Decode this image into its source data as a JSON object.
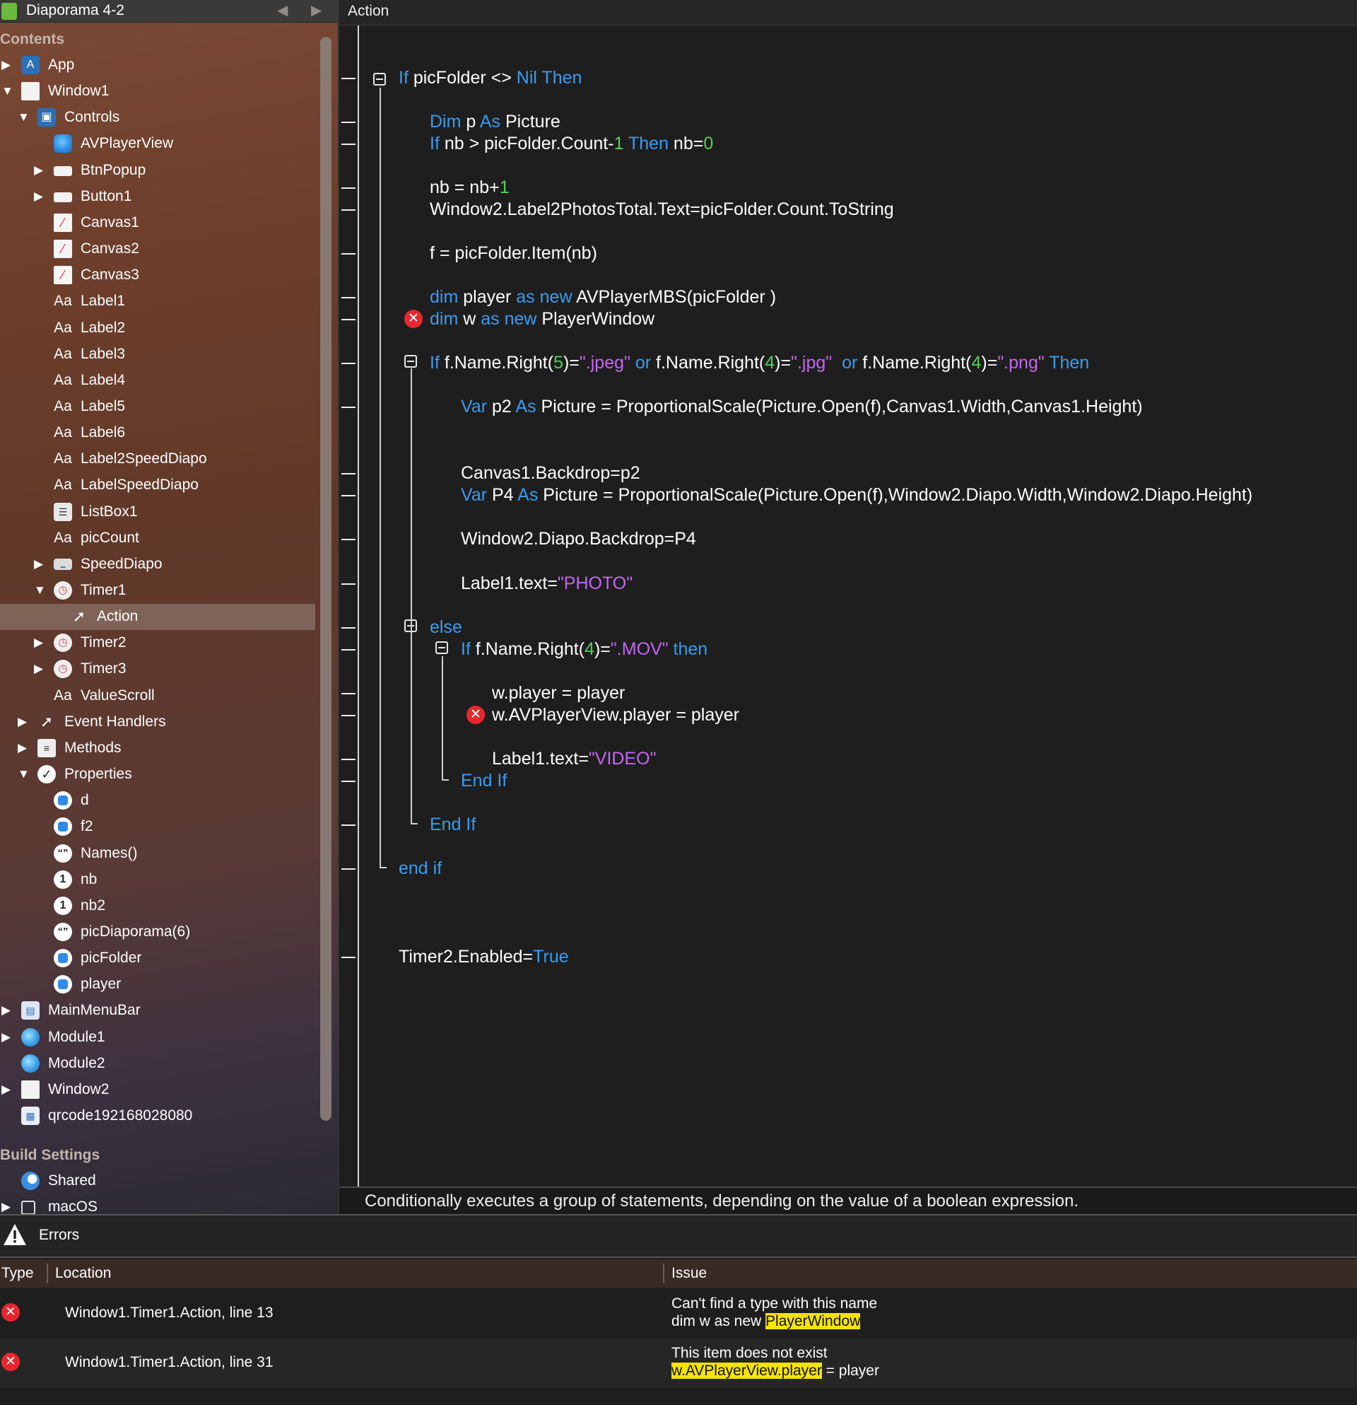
{
  "window": {
    "title": "Diaporama 4-2",
    "back_icon": "triangle-left-icon",
    "forward_icon": "triangle-right-icon"
  },
  "sidebar": {
    "contents_title": "Contents",
    "build_settings_title": "Build Settings",
    "tree": [
      {
        "label": "App",
        "icon": "app-icon",
        "disclosure": "collapsed",
        "level": 0
      },
      {
        "label": "Window1",
        "icon": "window-icon",
        "disclosure": "expanded",
        "level": 0
      },
      {
        "label": "Controls",
        "icon": "controls-icon",
        "disclosure": "expanded",
        "level": 1
      },
      {
        "label": "AVPlayerView",
        "icon": "cube-icon",
        "disclosure": "none",
        "level": 2
      },
      {
        "label": "BtnPopup",
        "icon": "button-icon",
        "disclosure": "collapsed",
        "level": 2
      },
      {
        "label": "Button1",
        "icon": "button-icon",
        "disclosure": "collapsed",
        "level": 2
      },
      {
        "label": "Canvas1",
        "icon": "canvas-icon",
        "disclosure": "none",
        "level": 2
      },
      {
        "label": "Canvas2",
        "icon": "canvas-icon",
        "disclosure": "none",
        "level": 2
      },
      {
        "label": "Canvas3",
        "icon": "canvas-icon",
        "disclosure": "none",
        "level": 2
      },
      {
        "label": "Label1",
        "icon": "label-icon",
        "disclosure": "none",
        "level": 2
      },
      {
        "label": "Label2",
        "icon": "label-icon",
        "disclosure": "none",
        "level": 2
      },
      {
        "label": "Label3",
        "icon": "label-icon",
        "disclosure": "none",
        "level": 2
      },
      {
        "label": "Label4",
        "icon": "label-icon",
        "disclosure": "none",
        "level": 2
      },
      {
        "label": "Label5",
        "icon": "label-icon",
        "disclosure": "none",
        "level": 2
      },
      {
        "label": "Label6",
        "icon": "label-icon",
        "disclosure": "none",
        "level": 2
      },
      {
        "label": "Label2SpeedDiapo",
        "icon": "label-icon",
        "disclosure": "none",
        "level": 2
      },
      {
        "label": "LabelSpeedDiapo",
        "icon": "label-icon",
        "disclosure": "none",
        "level": 2
      },
      {
        "label": "ListBox1",
        "icon": "listbox-icon",
        "disclosure": "none",
        "level": 2
      },
      {
        "label": "picCount",
        "icon": "label-icon",
        "disclosure": "none",
        "level": 2
      },
      {
        "label": "SpeedDiapo",
        "icon": "slider-icon",
        "disclosure": "collapsed",
        "level": 2
      },
      {
        "label": "Timer1",
        "icon": "timer-icon",
        "disclosure": "expanded",
        "level": 2
      },
      {
        "label": "Action",
        "icon": "event-cursor-icon",
        "disclosure": "none",
        "level": 3,
        "selected": true
      },
      {
        "label": "Timer2",
        "icon": "timer-icon",
        "disclosure": "collapsed",
        "level": 2
      },
      {
        "label": "Timer3",
        "icon": "timer-icon",
        "disclosure": "collapsed",
        "level": 2
      },
      {
        "label": "ValueScroll",
        "icon": "label-icon",
        "disclosure": "none",
        "level": 2
      },
      {
        "label": "Event Handlers",
        "icon": "event-cursor-icon",
        "disclosure": "collapsed",
        "level": 1
      },
      {
        "label": "Methods",
        "icon": "methods-icon",
        "disclosure": "collapsed",
        "level": 1
      },
      {
        "label": "Properties",
        "icon": "checkmark-icon",
        "disclosure": "expanded",
        "level": 1
      },
      {
        "label": "d",
        "icon": "property-icon",
        "disclosure": "none",
        "level": 2
      },
      {
        "label": "f2",
        "icon": "property-icon",
        "disclosure": "none",
        "level": 2
      },
      {
        "label": "Names()",
        "icon": "string-property-icon",
        "disclosure": "none",
        "level": 2
      },
      {
        "label": "nb",
        "icon": "integer-property-icon",
        "disclosure": "none",
        "level": 2
      },
      {
        "label": "nb2",
        "icon": "integer-property-icon",
        "disclosure": "none",
        "level": 2
      },
      {
        "label": "picDiaporama(6)",
        "icon": "string-property-icon",
        "disclosure": "none",
        "level": 2
      },
      {
        "label": "picFolder",
        "icon": "property-icon",
        "disclosure": "none",
        "level": 2
      },
      {
        "label": "player",
        "icon": "property-icon",
        "disclosure": "none",
        "level": 2
      },
      {
        "label": "MainMenuBar",
        "icon": "menubar-icon",
        "disclosure": "collapsed",
        "level": 0
      },
      {
        "label": "Module1",
        "icon": "module-icon",
        "disclosure": "collapsed",
        "level": 0
      },
      {
        "label": "Module2",
        "icon": "module-icon",
        "disclosure": "none",
        "level": 0
      },
      {
        "label": "Window2",
        "icon": "window-icon",
        "disclosure": "collapsed",
        "level": 0
      },
      {
        "label": "qrcode192168028080",
        "icon": "image-icon",
        "disclosure": "none",
        "level": 0
      }
    ],
    "build_items": [
      {
        "label": "Shared",
        "icon": "shared-icon",
        "disclosure": "none",
        "level": 0
      },
      {
        "label": "macOS",
        "icon": "checkbox-icon",
        "disclosure": "collapsed",
        "level": 0
      }
    ]
  },
  "editor": {
    "tab_title": "Action",
    "lines": [
      {
        "indent": 0,
        "parts": [
          [
            "k",
            "If"
          ],
          [
            "t",
            " picFolder <> "
          ],
          [
            "k",
            "Nil Then"
          ]
        ]
      },
      {
        "indent": 1,
        "parts": [
          [
            "k",
            "Dim"
          ],
          [
            "t",
            " p "
          ],
          [
            "k",
            "As"
          ],
          [
            "t",
            " Picture"
          ]
        ]
      },
      {
        "indent": 1,
        "parts": [
          [
            "k",
            "If"
          ],
          [
            "t",
            " nb > picFolder.Count-"
          ],
          [
            "n",
            "1"
          ],
          [
            "t",
            " "
          ],
          [
            "k",
            "Then"
          ],
          [
            "t",
            " nb="
          ],
          [
            "n",
            "0"
          ]
        ]
      },
      {
        "indent": 1,
        "parts": [
          [
            "t",
            "nb = nb+"
          ],
          [
            "n",
            "1"
          ]
        ]
      },
      {
        "indent": 1,
        "parts": [
          [
            "t",
            "Window2.Label2PhotosTotal.Text=picFolder.Count.ToString"
          ]
        ]
      },
      {
        "indent": 1,
        "parts": [
          [
            "t",
            "f = picFolder.Item(nb)"
          ]
        ]
      },
      {
        "indent": 1,
        "parts": [
          [
            "k",
            "dim"
          ],
          [
            "t",
            " player "
          ],
          [
            "k",
            "as new"
          ],
          [
            "t",
            " AVPlayerMBS(picFolder )"
          ]
        ]
      },
      {
        "indent": 1,
        "error": true,
        "parts": [
          [
            "k",
            "dim"
          ],
          [
            "t",
            " w "
          ],
          [
            "k",
            "as new"
          ],
          [
            "t",
            " PlayerWindow"
          ]
        ]
      },
      {
        "indent": 1,
        "parts": [
          [
            "k",
            "If"
          ],
          [
            "t",
            " f.Name.Right("
          ],
          [
            "n",
            "5"
          ],
          [
            "t",
            ")="
          ],
          [
            "s",
            "\".jpeg\""
          ],
          [
            "t",
            " "
          ],
          [
            "k",
            "or"
          ],
          [
            "t",
            " f.Name.Right("
          ],
          [
            "n",
            "4"
          ],
          [
            "t",
            ")="
          ],
          [
            "s",
            "\".jpg\""
          ],
          [
            "t",
            "  "
          ],
          [
            "k",
            "or"
          ],
          [
            "t",
            " f.Name.Right("
          ],
          [
            "n",
            "4"
          ],
          [
            "t",
            ")="
          ],
          [
            "s",
            "\".png\""
          ],
          [
            "t",
            " "
          ],
          [
            "k",
            "Then"
          ]
        ]
      },
      {
        "indent": 2,
        "parts": [
          [
            "k",
            "Var"
          ],
          [
            "t",
            " p2 "
          ],
          [
            "k",
            "As"
          ],
          [
            "t",
            " Picture = ProportionalScale(Picture.Open(f),Canvas1.Width,Canvas1.Height)"
          ]
        ]
      },
      {
        "indent": 2,
        "parts": [
          [
            "t",
            "Canvas1.Backdrop=p2"
          ]
        ]
      },
      {
        "indent": 2,
        "parts": [
          [
            "k",
            "Var"
          ],
          [
            "t",
            " P4 "
          ],
          [
            "k",
            "As"
          ],
          [
            "t",
            " Picture = ProportionalScale(Picture.Open(f),Window2.Diapo.Width,Window2.Diapo.Height)"
          ]
        ]
      },
      {
        "indent": 2,
        "parts": [
          [
            "t",
            "Window2.Diapo.Backdrop=P4"
          ]
        ]
      },
      {
        "indent": 2,
        "parts": [
          [
            "t",
            "Label1.text="
          ],
          [
            "s",
            "\"PHOTO\""
          ]
        ]
      },
      {
        "indent": 1,
        "parts": [
          [
            "k",
            "else"
          ]
        ]
      },
      {
        "indent": 2,
        "parts": [
          [
            "k",
            "If"
          ],
          [
            "t",
            " f.Name.Right("
          ],
          [
            "n",
            "4"
          ],
          [
            "t",
            ")="
          ],
          [
            "s",
            "\".MOV\""
          ],
          [
            "t",
            " "
          ],
          [
            "k",
            "then"
          ]
        ]
      },
      {
        "indent": 3,
        "parts": [
          [
            "t",
            "w.player = player"
          ]
        ]
      },
      {
        "indent": 3,
        "error": true,
        "parts": [
          [
            "t",
            "w.AVPlayerView.player = player"
          ]
        ]
      },
      {
        "indent": 3,
        "parts": [
          [
            "t",
            "Label1.text="
          ],
          [
            "s",
            "\"VIDEO\""
          ]
        ]
      },
      {
        "indent": 2,
        "parts": [
          [
            "k",
            "End If"
          ]
        ]
      },
      {
        "indent": 1,
        "parts": [
          [
            "k",
            "End If"
          ]
        ]
      },
      {
        "indent": 0,
        "parts": [
          [
            "k",
            "end if"
          ]
        ]
      },
      {
        "indent": 0,
        "parts": [
          [
            "t",
            "Timer2.Enabled="
          ],
          [
            "k",
            "True"
          ]
        ]
      }
    ],
    "hint": "Conditionally executes a group of statements, depending on the value of a boolean expression."
  },
  "errors_panel": {
    "title": "Errors",
    "warning_icon": "warning-triangle-icon",
    "columns": {
      "type": "Type",
      "location": "Location",
      "issue": "Issue"
    },
    "rows": [
      {
        "location": "Window1.Timer1.Action, line 13",
        "issue_line1": "Can't find a type with this name",
        "issue_prefix": "dim w as new ",
        "issue_highlight": "PlayerWindow",
        "issue_suffix": ""
      },
      {
        "location": "Window1.Timer1.Action, line 31",
        "issue_line1": "This item does not exist",
        "issue_prefix": "",
        "issue_highlight": "w.AVPlayerView.player",
        "issue_suffix": " = player"
      }
    ]
  },
  "colors": {
    "keyword": "#3a9bf0",
    "string": "#c466f0",
    "number": "#54d054",
    "error": "#e8262d",
    "highlight": "#f5e20a"
  }
}
